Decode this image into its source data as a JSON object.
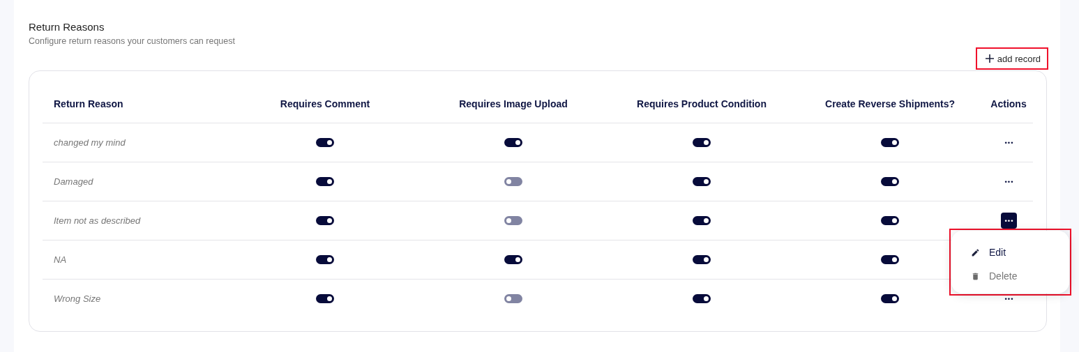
{
  "header": {
    "title": "Return Reasons",
    "subtitle": "Configure return reasons your customers can request"
  },
  "add_button": {
    "label": "add record",
    "highlighted": true
  },
  "table": {
    "columns": [
      "Return Reason",
      "Requires Comment",
      "Requires Image Upload",
      "Requires Product Condition",
      "Create Reverse Shipments?",
      "Actions"
    ],
    "rows": [
      {
        "reason": "changed my mind",
        "toggles": [
          {
            "on": true
          },
          {
            "on": true
          },
          {
            "on": true
          },
          {
            "on": true
          }
        ],
        "actions": "•••",
        "selected": false
      },
      {
        "reason": "Damaged",
        "toggles": [
          {
            "on": true
          },
          {
            "on": false
          },
          {
            "on": true
          },
          {
            "on": true
          }
        ],
        "actions": "•••",
        "selected": false
      },
      {
        "reason": "Item not as described",
        "toggles": [
          {
            "on": true
          },
          {
            "on": false
          },
          {
            "on": true
          },
          {
            "on": true
          }
        ],
        "actions": "•••",
        "selected": true
      },
      {
        "reason": "NA",
        "toggles": [
          {
            "on": true
          },
          {
            "on": true
          },
          {
            "on": true
          },
          {
            "on": true
          }
        ]
      },
      {
        "reason": "Wrong Size",
        "toggles": [
          {
            "on": true
          },
          {
            "on": false
          },
          {
            "on": true
          },
          {
            "on": true
          }
        ],
        "actions": "•••",
        "selected": false
      }
    ]
  },
  "menu": {
    "highlighted": true,
    "items": [
      {
        "label": "Edit",
        "kind": "edit",
        "disabled": false
      },
      {
        "label": "Delete",
        "kind": "delete",
        "disabled": true
      }
    ]
  }
}
